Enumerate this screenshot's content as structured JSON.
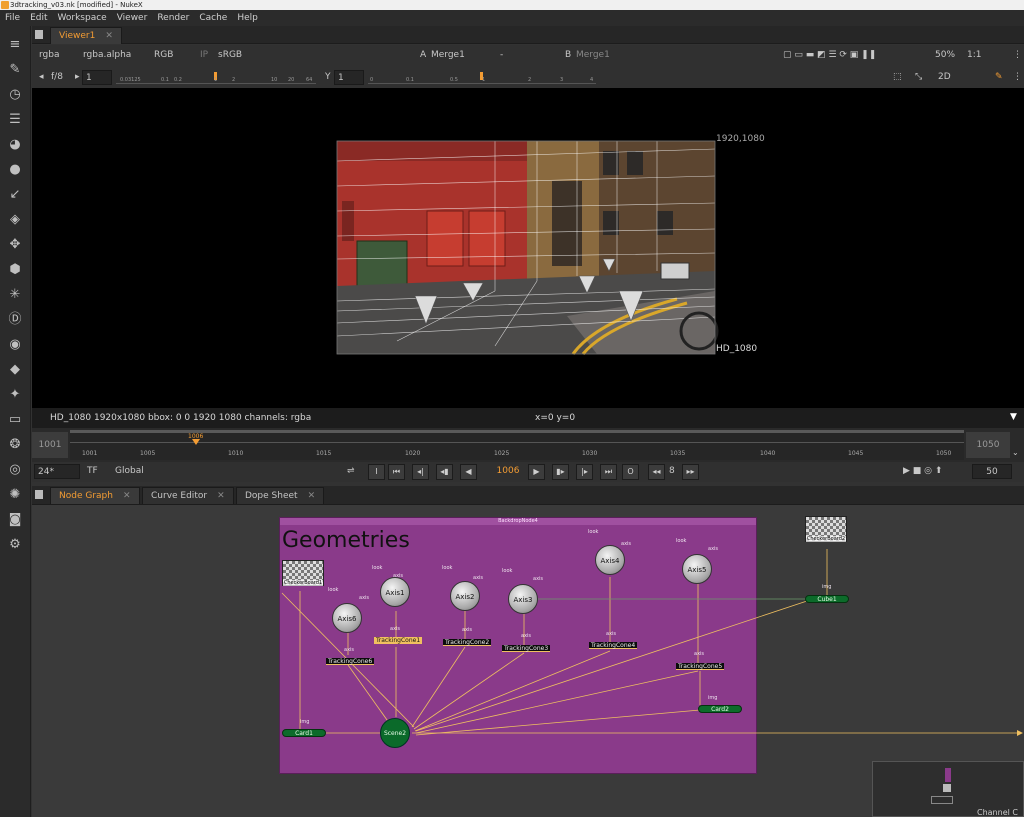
{
  "window": {
    "title": "3dtracking_v03.nk [modified] - NukeX"
  },
  "menu": [
    "File",
    "Edit",
    "Workspace",
    "Viewer",
    "Render",
    "Cache",
    "Help"
  ],
  "viewer_tab": {
    "label": "Viewer1",
    "close": "✕"
  },
  "viewer_controls": {
    "channels": "rgba",
    "alpha": "rgba.alpha",
    "colorspace_mode": "RGB",
    "ip": "IP",
    "lut": "sRGB",
    "input_a_label": "A",
    "input_a": "Merge1",
    "compare": "-",
    "input_b_label": "B",
    "input_b": "Merge1",
    "zoom": "50%",
    "ratio": "1:1",
    "view_mode": "2D"
  },
  "viewer_controls2": {
    "fstop": "f/8",
    "gain_value": "1",
    "gamma_label": "Y",
    "gamma_value": "1",
    "gain_ticks": [
      "0.03125",
      "0.1",
      "0.2",
      "1",
      "2",
      "10",
      "20",
      "64"
    ],
    "gamma_ticks": [
      "0",
      "0.1",
      "0.5",
      "1",
      "2",
      "3",
      "4"
    ]
  },
  "viewer_overlay": {
    "format_tr": "1920,1080",
    "format_br": "HD_1080"
  },
  "status": {
    "info": "HD_1080 1920x1080  bbox: 0 0 1920 1080 channels: rgba",
    "coords": "x=0 y=0"
  },
  "timeline": {
    "start": "1001",
    "end": "1050",
    "current": "1006",
    "ticks": [
      "1001",
      "1005",
      "1010",
      "1015",
      "1020",
      "1025",
      "1030",
      "1035",
      "1040",
      "1045",
      "1050"
    ]
  },
  "transport": {
    "fps": "24*",
    "tf": "TF",
    "scope": "Global",
    "frame": "1006",
    "step": "8",
    "playback_frames": "50"
  },
  "graph_tabs": [
    {
      "label": "Node Graph",
      "close": "✕"
    },
    {
      "label": "Curve Editor",
      "close": "✕"
    },
    {
      "label": "Dope Sheet",
      "close": "✕"
    }
  ],
  "backdrop": {
    "header": "BackdropNode4",
    "title": "Geometries"
  },
  "nodes": {
    "axis": [
      "Axis1",
      "Axis2",
      "Axis3",
      "Axis4",
      "Axis5",
      "Axis6"
    ],
    "cones": [
      "TrackingCone1",
      "TrackingCone2",
      "TrackingCone3",
      "TrackingCone4",
      "TrackingCone5",
      "TrackingCone6"
    ],
    "checker1": "CheckerBoard1",
    "checker2": "CheckerBoard2",
    "card1": "Card1",
    "card2": "Card2",
    "cube1": "Cube1",
    "scene2": "Scene2",
    "look": "look",
    "axis_in": "axis",
    "img": "img"
  },
  "bottom_right": "Channel C",
  "colors": {
    "accent": "#f39c33",
    "backdrop": "#8a3a8a",
    "green_node": "#0c6b2a"
  }
}
